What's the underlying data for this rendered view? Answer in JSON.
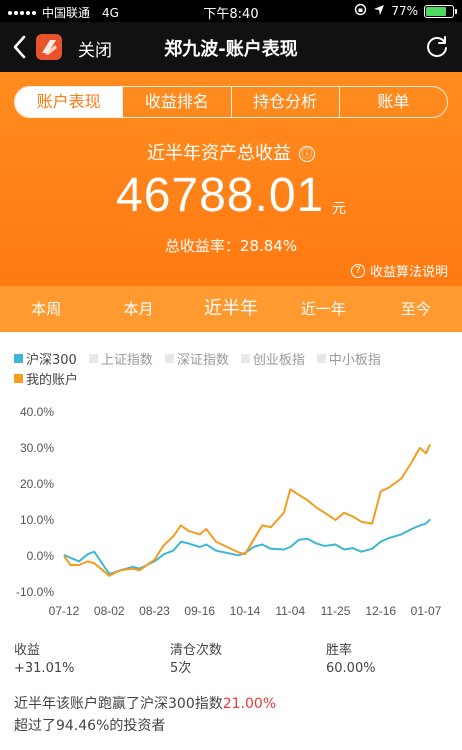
{
  "status_bar": {
    "carrier": "中国联通",
    "network": "4G",
    "time": "下午8:40",
    "battery_pct": "77%",
    "battery_level": 0.77
  },
  "nav": {
    "close_label": "关闭",
    "title": "郑九波-账户表现",
    "back_icon": "chevron-left-icon",
    "refresh_icon": "refresh-icon"
  },
  "tabs": [
    "账户表现",
    "收益排名",
    "持仓分析",
    "账单"
  ],
  "summary": {
    "label": "近半年资产总收益",
    "info_icon": "ⓘ",
    "total": "46788.01",
    "unit": "元",
    "rate_label": "总收益率：",
    "rate_value": "28.84%",
    "algo_icon": "?",
    "algo_link": "收益算法说明"
  },
  "periods": [
    "本周",
    "本月",
    "近半年",
    "近一年",
    "至今"
  ],
  "legend": [
    {
      "label": "沪深300",
      "color": "#3fb7d4",
      "on": true
    },
    {
      "label": "上证指数",
      "color": "#e8e8e8",
      "on": false
    },
    {
      "label": "深证指数",
      "color": "#e8e8e8",
      "on": false
    },
    {
      "label": "创业板指",
      "color": "#e8e8e8",
      "on": false
    },
    {
      "label": "中小板指",
      "color": "#e8e8e8",
      "on": false
    },
    {
      "label": "我的账户",
      "color": "#f39c1e",
      "on": true
    }
  ],
  "chart_data": {
    "type": "line",
    "x_ticks": [
      "07-12",
      "08-02",
      "08-23",
      "09-16",
      "10-14",
      "11-04",
      "11-25",
      "12-16",
      "01-07"
    ],
    "y_ticks": [
      "40.0%",
      "30.0%",
      "20.0%",
      "10.0%",
      "0.0%",
      "-10.0%"
    ],
    "ylim": [
      -10,
      40
    ],
    "grid": false,
    "series": [
      {
        "name": "沪深300",
        "color": "#3fb7d4",
        "x": [
          "07-12",
          "07-15",
          "07-19",
          "07-23",
          "07-26",
          "08-02",
          "08-07",
          "08-13",
          "08-16",
          "08-23",
          "08-28",
          "09-02",
          "09-06",
          "09-10",
          "09-16",
          "09-20",
          "09-26",
          "10-10",
          "10-14",
          "10-18",
          "10-22",
          "10-26",
          "11-01",
          "11-04",
          "11-08",
          "11-12",
          "11-16",
          "11-20",
          "11-25",
          "11-29",
          "12-03",
          "12-07",
          "12-12",
          "12-16",
          "12-20",
          "12-26",
          "12-31",
          "01-04",
          "01-07",
          "01-09"
        ],
        "values": [
          0.3,
          -0.5,
          -1.5,
          0.5,
          1.2,
          -5.0,
          -4.0,
          -3.0,
          -3.5,
          -1.5,
          0.5,
          1.5,
          4.0,
          3.5,
          2.5,
          3.2,
          1.5,
          0.2,
          0.8,
          2.5,
          3.2,
          2.0,
          1.8,
          2.5,
          4.5,
          4.8,
          3.5,
          2.8,
          3.2,
          1.8,
          2.2,
          1.2,
          2.0,
          4.0,
          5.0,
          6.0,
          7.5,
          8.5,
          9.0,
          10.2
        ]
      },
      {
        "name": "我的账户",
        "color": "#f39c1e",
        "x": [
          "07-12",
          "07-15",
          "07-19",
          "07-23",
          "07-26",
          "08-02",
          "08-07",
          "08-13",
          "08-16",
          "08-23",
          "08-28",
          "09-02",
          "09-06",
          "09-10",
          "09-16",
          "09-20",
          "09-26",
          "10-10",
          "10-14",
          "10-18",
          "10-22",
          "10-26",
          "11-01",
          "11-04",
          "11-08",
          "11-12",
          "11-16",
          "11-20",
          "11-25",
          "11-29",
          "12-03",
          "12-07",
          "12-12",
          "12-16",
          "12-20",
          "12-26",
          "12-31",
          "01-04",
          "01-07",
          "01-09"
        ],
        "values": [
          0.0,
          -2.5,
          -2.5,
          -1.5,
          -2.0,
          -5.5,
          -4.0,
          -3.5,
          -4.0,
          -1.0,
          3.0,
          5.5,
          8.5,
          7.0,
          6.0,
          7.5,
          4.0,
          1.0,
          0.5,
          4.5,
          8.5,
          8.0,
          12.0,
          18.5,
          17.0,
          15.5,
          13.5,
          12.0,
          10.0,
          12.0,
          11.0,
          9.5,
          9.0,
          18.0,
          19.0,
          21.5,
          26.0,
          30.0,
          28.5,
          31.0
        ]
      }
    ]
  },
  "stats": [
    {
      "label": "收益",
      "value": "+31.01%"
    },
    {
      "label": "清仓次数",
      "value": "5次"
    },
    {
      "label": "胜率",
      "value": "60.00%"
    }
  ],
  "beat": {
    "prefix": "近半年该账户跑赢了沪深300指数",
    "diff": "21.00%",
    "line2": "超过了94.46%的投资者"
  }
}
